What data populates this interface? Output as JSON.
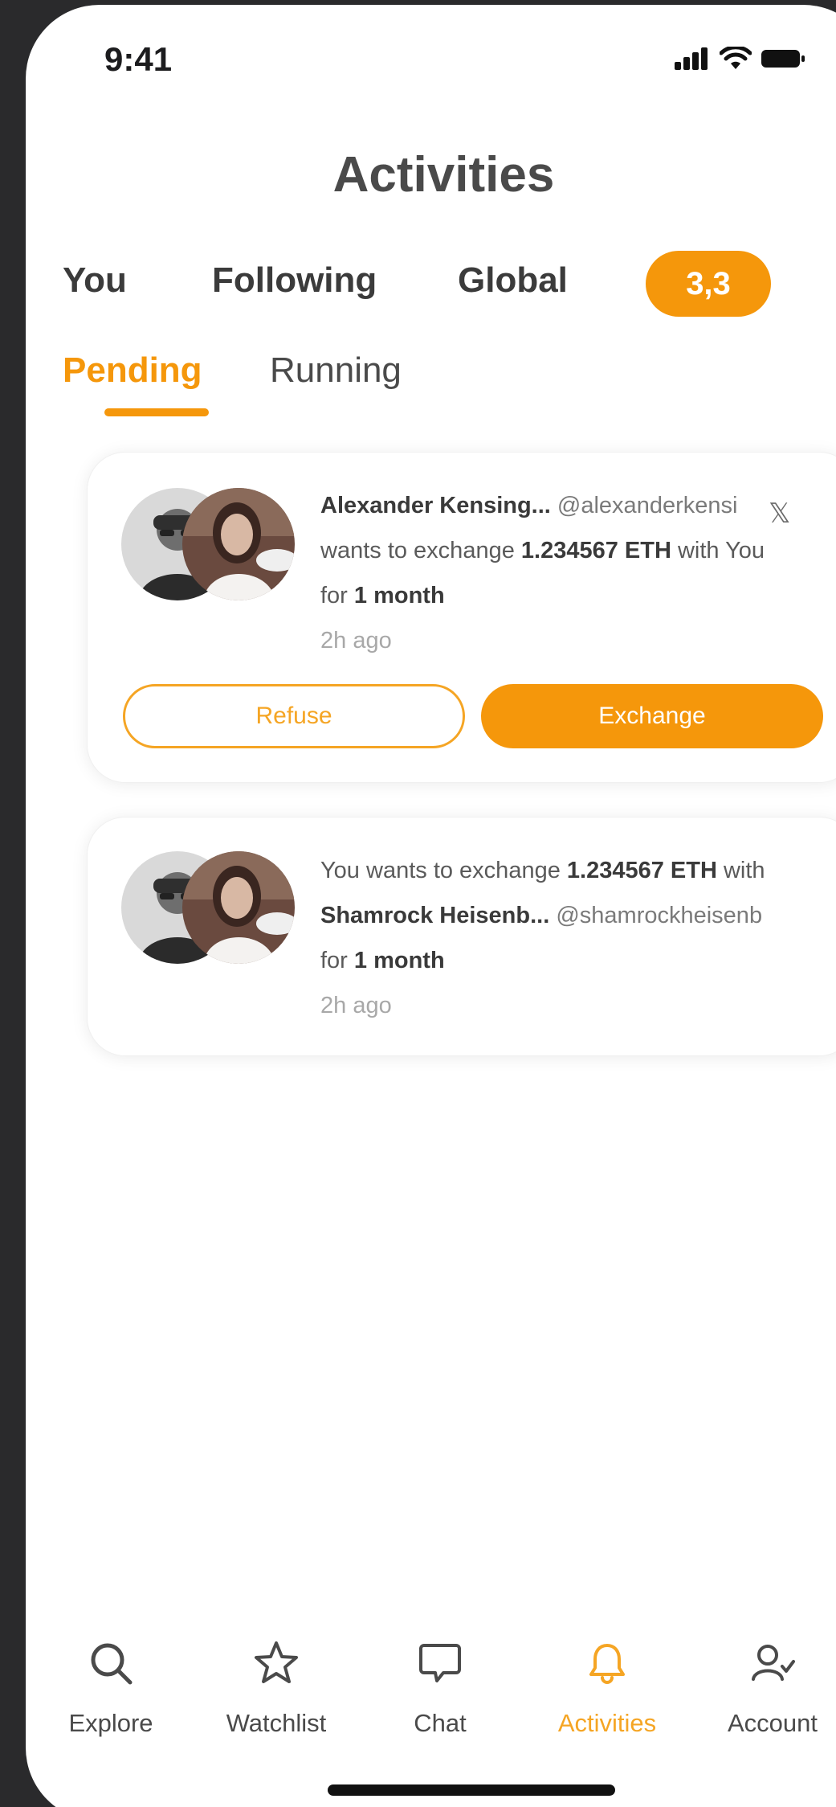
{
  "status_bar": {
    "time": "9:41"
  },
  "header": {
    "title": "Activities"
  },
  "filter_tabs": [
    {
      "label": "You"
    },
    {
      "label": "Following"
    },
    {
      "label": "Global"
    }
  ],
  "count_badge": "3,3",
  "sub_tabs": [
    {
      "label": "Pending",
      "active": true
    },
    {
      "label": "Running",
      "active": false
    }
  ],
  "activities": [
    {
      "name": "Alexander Kensing...",
      "handle": "@alexanderkensi",
      "social_icon": "x-icon",
      "line2_prefix": "wants to exchange",
      "amount": "1.234567 ETH",
      "line2_with": "with",
      "line2_target": "You",
      "duration_prefix": "for",
      "duration": "1 month",
      "time_ago": "2h ago",
      "refuse_label": "Refuse",
      "exchange_label": "Exchange"
    },
    {
      "line1_subject": "You",
      "line1_text": "wants to exchange",
      "amount": "1.234567 ETH",
      "line1_with": "with",
      "name": "Shamrock Heisenb...",
      "handle": "@shamrockheisenb",
      "duration_prefix": "for",
      "duration": "1 month",
      "time_ago": "2h ago"
    }
  ],
  "bottom_nav": [
    {
      "label": "Explore",
      "icon": "search-icon"
    },
    {
      "label": "Watchlist",
      "icon": "star-icon"
    },
    {
      "label": "Chat",
      "icon": "chat-icon"
    },
    {
      "label": "Activities",
      "icon": "bell-icon",
      "active": true
    },
    {
      "label": "Account",
      "icon": "account-icon"
    }
  ],
  "colors": {
    "accent": "#f5970b",
    "text": "#4a4a4a",
    "muted": "#a8a8a8"
  }
}
